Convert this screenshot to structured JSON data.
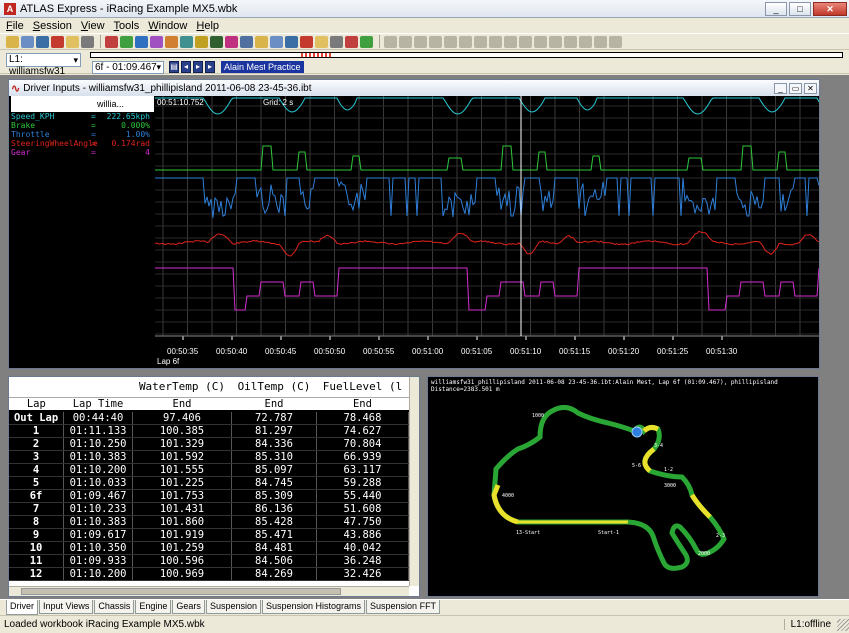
{
  "window": {
    "title": "ATLAS Express - iRacing Example MX5.wbk",
    "app_icon": "A"
  },
  "menu": [
    "File",
    "Session",
    "View",
    "Tools",
    "Window",
    "Help"
  ],
  "toolbar2": {
    "lap_selector": "L1: williamsfw31",
    "lap_combo": "6f - 01:09.467",
    "tags": [
      "Alain Mest",
      "Practice"
    ]
  },
  "chart_window": {
    "title": "Driver Inputs - williamsfw31_phillipisland 2011-06-08 23-45-36.ibt",
    "header": "willia...",
    "cursor_time": "00:51:10.752",
    "grid": "Grid: 2 s",
    "lap_label": "Lap 6f",
    "params": [
      {
        "name": "Speed_KPH",
        "value": "222.65kph",
        "color": "#29c9d6"
      },
      {
        "name": "Brake",
        "value": "0.000%",
        "color": "#2ec83c"
      },
      {
        "name": "Throttle",
        "value": "1.00%",
        "color": "#2e7fd8"
      },
      {
        "name": "SteeringWheelAngle",
        "value": "0.174rad",
        "color": "#e0231c"
      },
      {
        "name": "Gear",
        "value": "4",
        "color": "#d42fd0"
      }
    ],
    "time_ticks": [
      "00:50:35",
      "00:50:40",
      "00:50:45",
      "00:50:50",
      "00:50:55",
      "00:51:00",
      "00:51:05",
      "00:51:10",
      "00:51:15",
      "00:51:20",
      "00:51:25",
      "00:51:30"
    ]
  },
  "chart_data": {
    "type": "line",
    "x_label": "",
    "x": [
      "00:50:35",
      "00:50:40",
      "00:50:45",
      "00:50:50",
      "00:50:55",
      "00:51:00",
      "00:51:05",
      "00:51:10",
      "00:51:15",
      "00:51:20",
      "00:51:25",
      "00:51:30"
    ],
    "series": [
      {
        "name": "Speed_KPH",
        "color": "#29c9d6"
      },
      {
        "name": "Brake",
        "color": "#2ec83c"
      },
      {
        "name": "Throttle",
        "color": "#2e7fd8"
      },
      {
        "name": "SteeringWheelAngle",
        "color": "#e0231c"
      },
      {
        "name": "Gear",
        "color": "#d42fd0"
      }
    ],
    "grid": true
  },
  "table": {
    "group_headers": [
      "",
      "",
      "WaterTemp (C)",
      "OilTemp (C)",
      "FuelLevel (l"
    ],
    "col_headers": [
      "Lap",
      "Lap Time",
      "End",
      "End",
      "End"
    ],
    "rows": [
      [
        "Out Lap",
        "00:44:40",
        "97.406",
        "72.787",
        "78.468"
      ],
      [
        "1",
        "01:11.133",
        "100.385",
        "81.297",
        "74.627"
      ],
      [
        "2",
        "01:10.250",
        "101.329",
        "84.336",
        "70.804"
      ],
      [
        "3",
        "01:10.383",
        "101.592",
        "85.310",
        "66.939"
      ],
      [
        "4",
        "01:10.200",
        "101.555",
        "85.097",
        "63.117"
      ],
      [
        "5",
        "01:10.033",
        "101.225",
        "84.745",
        "59.288"
      ],
      [
        "6f",
        "01:09.467",
        "101.753",
        "85.309",
        "55.440"
      ],
      [
        "7",
        "01:10.233",
        "101.431",
        "86.136",
        "51.608"
      ],
      [
        "8",
        "01:10.383",
        "101.860",
        "85.428",
        "47.750"
      ],
      [
        "9",
        "01:09.617",
        "101.919",
        "85.471",
        "43.886"
      ],
      [
        "10",
        "01:10.350",
        "101.259",
        "84.481",
        "40.042"
      ],
      [
        "11",
        "01:09.933",
        "100.596",
        "84.506",
        "36.248"
      ],
      [
        "12",
        "01:10.200",
        "100.969",
        "84.269",
        "32.426"
      ]
    ]
  },
  "map": {
    "info_line1": "williamsfw31_phillipisland 2011-06-08 23-45-36.ibt:Alain Mest, Lap 6f (01:09.467), phillipisland",
    "info_line2": "Distance=2383.501 m",
    "labels": [
      "13-Start",
      "Start-1",
      "1000",
      "2000",
      "3000",
      "4000",
      "5-6",
      "1-2",
      "2-3",
      "3-4"
    ]
  },
  "tabs": [
    "Driver",
    "Input Views",
    "Chassis",
    "Engine",
    "Gears",
    "Suspension",
    "Suspension Histograms",
    "Suspension FFT"
  ],
  "active_tab": "Driver",
  "status": {
    "text": "Loaded workbook iRacing Example MX5.wbk",
    "connection": "L1:offline"
  }
}
